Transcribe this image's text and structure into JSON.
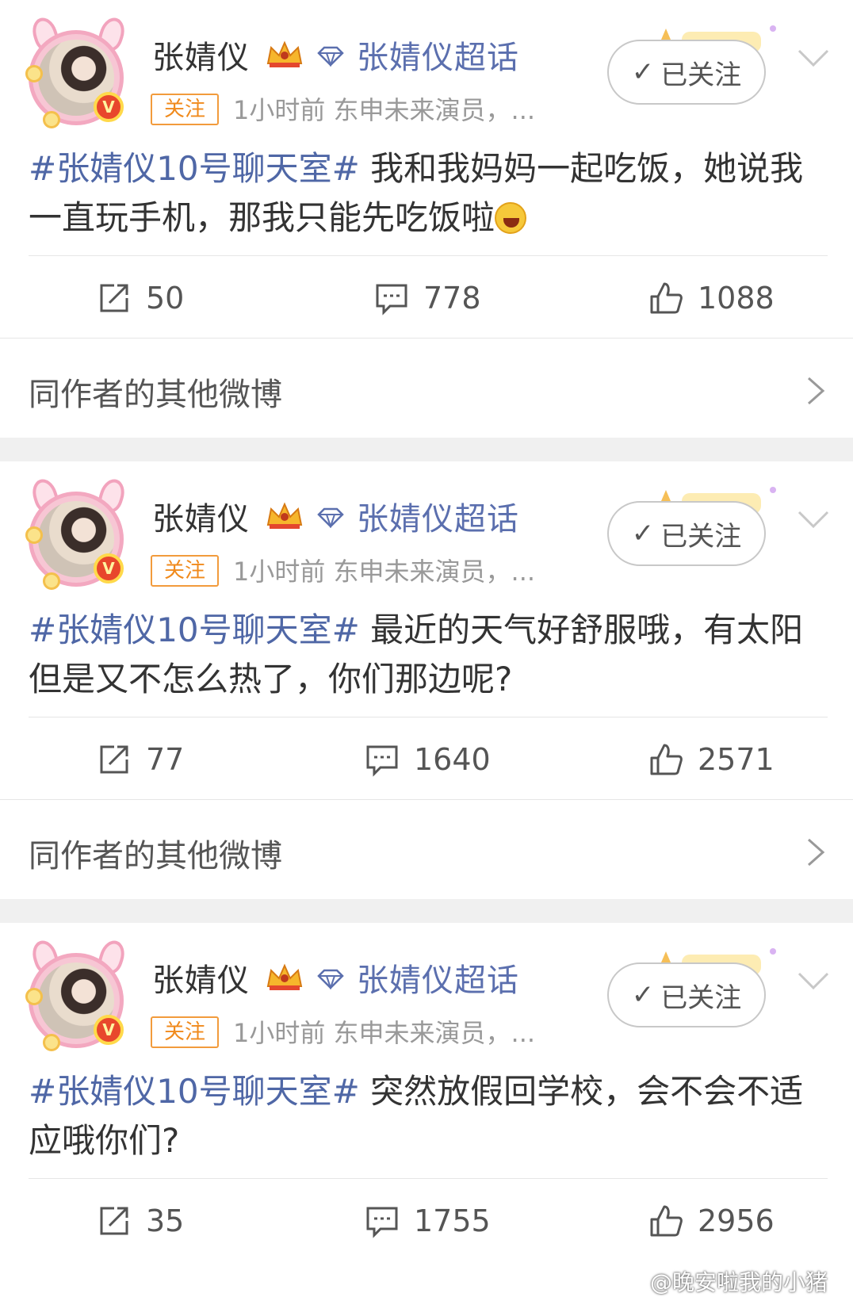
{
  "posts": [
    {
      "author": "张婧仪",
      "supertopic": "张婧仪超话",
      "follow_tag": "关注",
      "meta": "1小时前  东申未来演员，...",
      "follow_button": "已关注",
      "hashtag": "#张婧仪10号聊天室#",
      "text": " 我和我妈妈一起吃饭，她说我一直玩手机，那我只能先吃饭啦",
      "has_emoji": true,
      "reposts": "50",
      "comments": "778",
      "likes": "1088",
      "more_label": "同作者的其他微博"
    },
    {
      "author": "张婧仪",
      "supertopic": "张婧仪超话",
      "follow_tag": "关注",
      "meta": "1小时前  东申未来演员，...",
      "follow_button": "已关注",
      "hashtag": "#张婧仪10号聊天室#",
      "text": " 最近的天气好舒服哦，有太阳但是又不怎么热了，你们那边呢?",
      "has_emoji": false,
      "reposts": "77",
      "comments": "1640",
      "likes": "2571",
      "more_label": "同作者的其他微博"
    },
    {
      "author": "张婧仪",
      "supertopic": "张婧仪超话",
      "follow_tag": "关注",
      "meta": "1小时前  东申未来演员，...",
      "follow_button": "已关注",
      "hashtag": "#张婧仪10号聊天室#",
      "text": " 突然放假回学校，会不会不适应哦你们?",
      "has_emoji": false,
      "reposts": "35",
      "comments": "1755",
      "likes": "2956"
    }
  ],
  "icons": {
    "avatar_badge": "V",
    "repost": "repost-icon",
    "comment": "comment-icon",
    "like": "like-icon"
  },
  "watermark": "@晚安啦我的小猪",
  "colors": {
    "hashtag": "#4f67a6",
    "supertopic": "#5b6fae",
    "follow_tag": "#f08a1c",
    "section_gap": "#f0f0f0"
  }
}
